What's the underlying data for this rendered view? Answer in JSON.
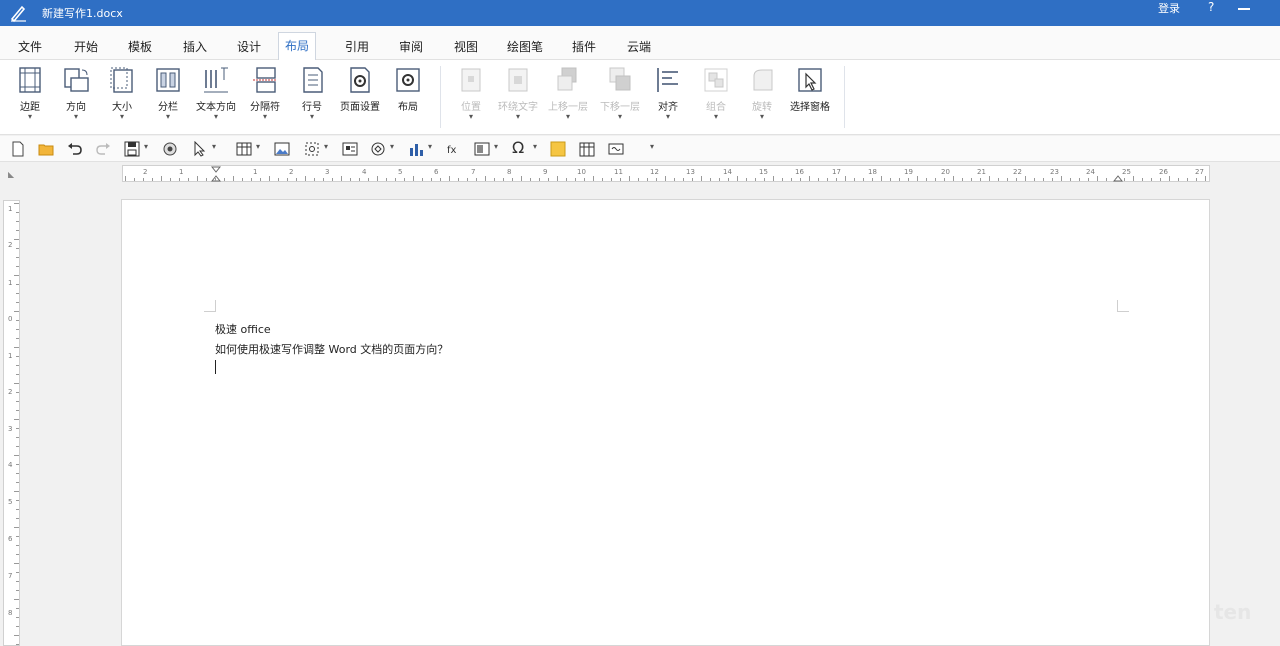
{
  "titlebar": {
    "doc_title": "新建写作1.docx",
    "login_label": "登录",
    "help_label": "?"
  },
  "menu": {
    "tabs": [
      "文件",
      "开始",
      "模板",
      "插入",
      "设计",
      "布局",
      "引用",
      "审阅",
      "视图",
      "绘图笔",
      "插件",
      "云端"
    ],
    "active_tab": "布局"
  },
  "ribbon": {
    "buttons": [
      {
        "label": "边距",
        "icon": "margins-icon",
        "enabled": true
      },
      {
        "label": "方向",
        "icon": "orientation-icon",
        "enabled": true
      },
      {
        "label": "大小",
        "icon": "page-size-icon",
        "enabled": true
      },
      {
        "label": "分栏",
        "icon": "columns-icon",
        "enabled": true
      },
      {
        "label": "文本方向",
        "icon": "text-direction-icon",
        "enabled": true
      },
      {
        "label": "分隔符",
        "icon": "breaks-icon",
        "enabled": true
      },
      {
        "label": "行号",
        "icon": "line-numbers-icon",
        "enabled": true
      },
      {
        "label": "页面设置",
        "icon": "page-setup-icon",
        "enabled": true
      },
      {
        "label": "布局",
        "icon": "layout-settings-icon",
        "enabled": true
      },
      {
        "label": "位置",
        "icon": "position-icon",
        "enabled": false
      },
      {
        "label": "环绕文字",
        "icon": "wrap-text-icon",
        "enabled": false
      },
      {
        "label": "上移一层",
        "icon": "bring-forward-icon",
        "enabled": false
      },
      {
        "label": "下移一层",
        "icon": "send-backward-icon",
        "enabled": false
      },
      {
        "label": "对齐",
        "icon": "align-icon",
        "enabled": true
      },
      {
        "label": "组合",
        "icon": "group-icon",
        "enabled": false
      },
      {
        "label": "旋转",
        "icon": "rotate-icon",
        "enabled": false
      },
      {
        "label": "选择窗格",
        "icon": "selection-pane-icon",
        "enabled": true
      }
    ]
  },
  "toolbar": {
    "icons": [
      "new-doc-icon",
      "open-folder-icon",
      "undo-icon",
      "redo-icon",
      "save-icon",
      "print-icon",
      "pointer-icon",
      "table-icon",
      "image-icon",
      "screenshot-icon",
      "shape-icon",
      "smartart-icon",
      "chart-icon",
      "textbox-icon",
      "field-icon",
      "symbol-icon",
      "note-icon",
      "calendar-icon",
      "link-icon"
    ],
    "symbol_glyph": "Ω"
  },
  "ruler": {
    "h_numbers": [
      "2",
      "1",
      "1",
      "2",
      "3",
      "4",
      "5",
      "6",
      "7",
      "8",
      "9",
      "10",
      "11",
      "12",
      "13",
      "14",
      "15",
      "16",
      "17",
      "18",
      "19",
      "20",
      "21",
      "22",
      "23",
      "24",
      "25",
      "26",
      "27"
    ],
    "v_numbers": [
      "1",
      "2",
      "1",
      "0",
      "1",
      "2",
      "3",
      "4",
      "5",
      "6",
      "7",
      "8"
    ]
  },
  "document": {
    "line1": "极速 office",
    "line2": "如何使用极速写作调整 Word 文档的页面方向？"
  },
  "watermark": "ten"
}
